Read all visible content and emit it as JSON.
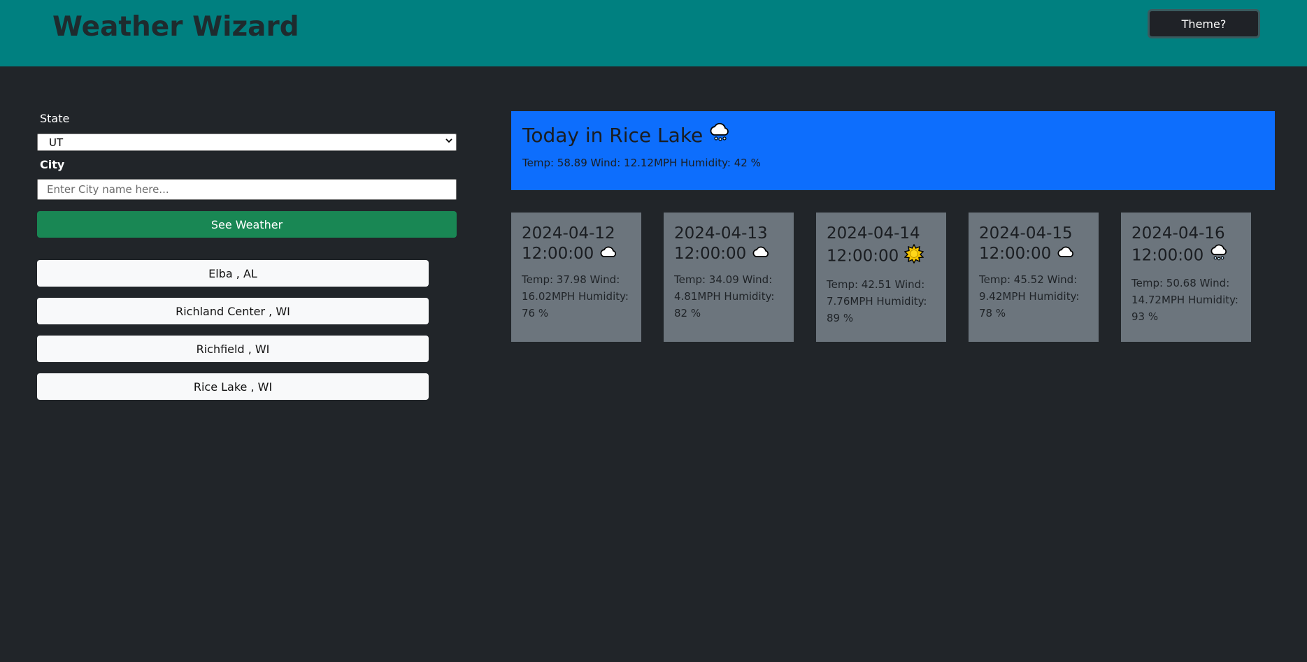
{
  "header": {
    "title": "Weather Wizard",
    "theme_button": "Theme?"
  },
  "form": {
    "state_label": "State",
    "state_value": "UT",
    "city_label": "City",
    "city_placeholder": "Enter City name here...",
    "submit_label": "See Weather"
  },
  "history": [
    {
      "label": "Elba , AL"
    },
    {
      "label": "Richland Center , WI"
    },
    {
      "label": "Richfield , WI"
    },
    {
      "label": "Rice Lake , WI"
    }
  ],
  "today": {
    "title": "Today in Rice Lake",
    "icon": "rain-cloud-icon",
    "info": "Temp: 58.89 Wind: 12.12MPH Humidity: 42 %"
  },
  "forecast": [
    {
      "date": "2024-04-12",
      "time": "12:00:00",
      "icon": "cloud-icon",
      "info": "Temp: 37.98 Wind: 16.02MPH Humidity: 76 %"
    },
    {
      "date": "2024-04-13",
      "time": "12:00:00",
      "icon": "cloud-icon",
      "info": "Temp: 34.09 Wind: 4.81MPH Humidity: 82 %"
    },
    {
      "date": "2024-04-14",
      "time": "12:00:00",
      "icon": "sun-icon",
      "info": "Temp: 42.51 Wind: 7.76MPH Humidity: 89 %"
    },
    {
      "date": "2024-04-15",
      "time": "12:00:00",
      "icon": "cloud-icon",
      "info": "Temp: 45.52 Wind: 9.42MPH Humidity: 78 %"
    },
    {
      "date": "2024-04-16",
      "time": "12:00:00",
      "icon": "rain-cloud-icon",
      "info": "Temp: 50.68 Wind: 14.72MPH Humidity: 93 %"
    }
  ],
  "colors": {
    "header_bg": "#008080",
    "page_bg": "#212529",
    "today_bg": "#0d6efd",
    "card_bg": "#6c757d",
    "submit_bg": "#198754"
  }
}
